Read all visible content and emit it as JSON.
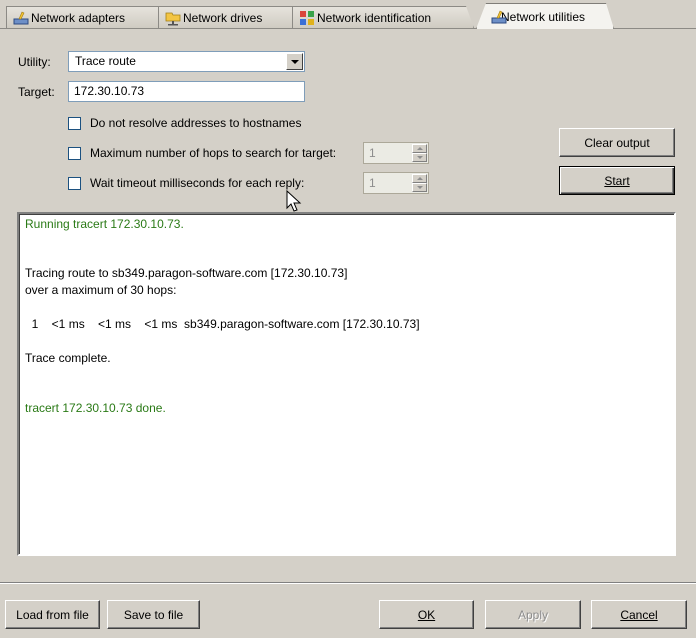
{
  "tabs": [
    {
      "label": "Network adapters",
      "icon": "network-adapter-icon",
      "active": false
    },
    {
      "label": "Network drives",
      "icon": "network-drive-icon",
      "active": false
    },
    {
      "label": "Network identification",
      "icon": "network-identification-icon",
      "active": false
    },
    {
      "label": "Network utilities",
      "icon": "network-utilities-icon",
      "active": true
    }
  ],
  "form": {
    "utility_label": "Utility:",
    "utility_value": "Trace route",
    "target_label": "Target:",
    "target_value": "172.30.10.73"
  },
  "options": {
    "no_resolve_label": "Do not resolve addresses to hostnames",
    "max_hops_label": "Maximum number of hops to search for target:",
    "max_hops_value": "1",
    "timeout_label": "Wait timeout milliseconds for each reply:",
    "timeout_value": "1"
  },
  "actions": {
    "clear_output": "Clear output",
    "start": "Start"
  },
  "output": {
    "lines": [
      {
        "text": "Running tracert 172.30.10.73.",
        "color": "green"
      },
      {
        "text": "Tracing route to sb349.paragon-software.com [172.30.10.73]",
        "color": "black"
      },
      {
        "text": "over a maximum of 30 hops:",
        "color": "black"
      },
      {
        "text": "  1    <1 ms    <1 ms    <1 ms  sb349.paragon-software.com [172.30.10.73]",
        "color": "black"
      },
      {
        "text": "Trace complete.",
        "color": "black"
      },
      {
        "text": "tracert 172.30.10.73 done.",
        "color": "green"
      }
    ]
  },
  "footer": {
    "load": "Load from file",
    "save": "Save to file",
    "ok": "OK",
    "apply": "Apply",
    "cancel": "Cancel"
  },
  "colors": {
    "window": "#d4d0c8",
    "success_text": "#2a7a16"
  }
}
